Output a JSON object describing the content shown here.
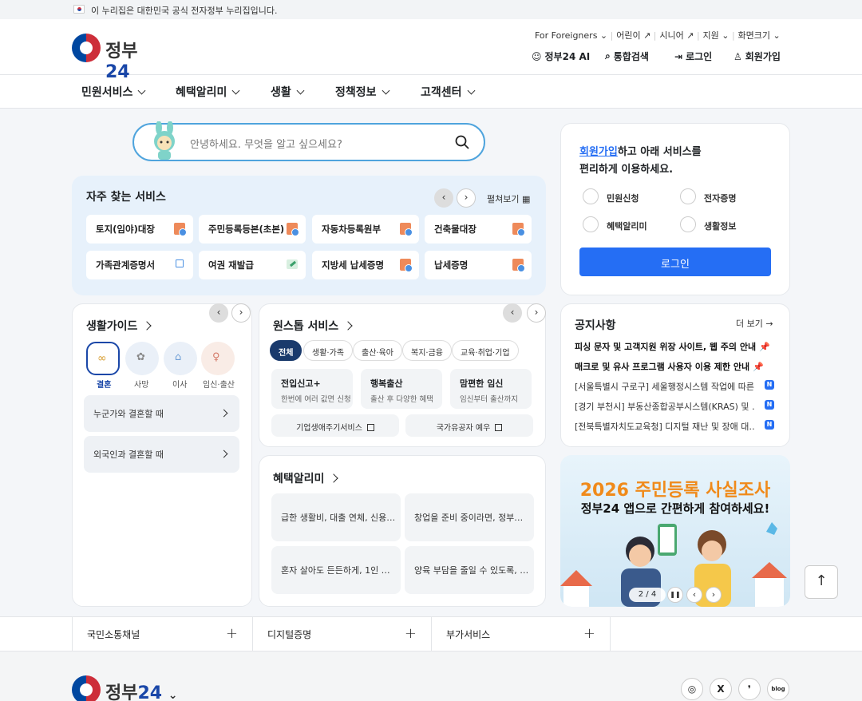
{
  "topbar": {
    "notice": "이 누리집은 대한민국 공식 전자정부 누리집입니다."
  },
  "header": {
    "logo_text": "정부",
    "logo_num": "24",
    "util": [
      "For Foreigners",
      "어린이",
      "시니어",
      "지원",
      "화면크기"
    ],
    "actions": [
      "정부24 AI",
      "통합검색",
      "로그인",
      "회원가입"
    ]
  },
  "gnb": [
    "민원서비스",
    "혜택알리미",
    "생활",
    "정책정보",
    "고객센터"
  ],
  "search": {
    "placeholder": "안녕하세요. 무엇을 알고 싶으세요?"
  },
  "frequent": {
    "title": "자주 찾는 서비스",
    "expand": "펼쳐보기",
    "items": [
      "토지(임야)대장",
      "주민등록등본(초본)",
      "자동차등록원부",
      "건축물대장",
      "가족관계증명서",
      "여권 재발급",
      "지방세 납세증명",
      "납세증명"
    ]
  },
  "guide": {
    "title": "생활가이드",
    "tabs": [
      "결혼",
      "사망",
      "이사",
      "임신·출산"
    ],
    "rows": [
      "누군가와 결혼할 때",
      "외국인과 결혼할 때"
    ]
  },
  "onestop": {
    "title": "원스톱 서비스",
    "chips": [
      "전체",
      "생활·가족",
      "출산·육아",
      "복지·금융",
      "교육·취업·기업"
    ],
    "services": [
      {
        "name": "전입신고+",
        "desc": "한번에 여러 값면 신청"
      },
      {
        "name": "행복출산",
        "desc": "출산 후 다양한 혜택"
      },
      {
        "name": "맘편한 임신",
        "desc": "임신부터 출산까지"
      }
    ],
    "links": [
      "기업생애주기서비스",
      "국가유공자 예우"
    ]
  },
  "benefit": {
    "title": "혜택알리미",
    "items": [
      "급한 생활비, 대출 연체, 신용…",
      "창업을 준비 중이라면, 정부…",
      "혼자 살아도 든든하게, 1인 …",
      "양육 부담을 줄일 수 있도록, …"
    ]
  },
  "member": {
    "link": "회원가입",
    "line1_rest": "하고 아래 서비스를",
    "line2": "편리하게 이용하세요.",
    "services": [
      "민원신청",
      "전자증명",
      "혜택알리미",
      "생활정보"
    ],
    "login": "로그인"
  },
  "notice": {
    "title": "공지사항",
    "more": "더 보기 →",
    "pinned": [
      "피싱 문자 및 고객지원 위장 사이트, 웹 주의 안내",
      "매크로 및 유사 프로그램 사용자 이용 제한 안내"
    ],
    "items": [
      "[서울특별시 구로구] 세울행정시스템 작업에 따른…",
      "[경기 부천시] 부동산종합공부시스템(KRAS) 및 …",
      "[전북특별자치도교육청] 디지털 재난 및 장애 대…"
    ],
    "badge": "N"
  },
  "banner": {
    "headline": "2026 주민등록 사실조사",
    "sub": "정부24 앱으로 간편하게 참여하세요!",
    "page": "2 / 4"
  },
  "bottom": [
    "국민소통채널",
    "디지털증명",
    "부가서비스"
  ],
  "sns": [
    "IG",
    "X",
    "❜",
    "blog"
  ]
}
